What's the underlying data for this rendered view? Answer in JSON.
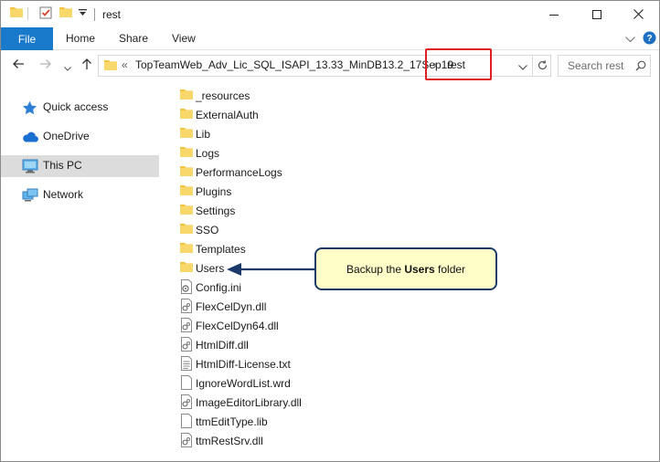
{
  "window": {
    "title": "rest",
    "controls": {
      "minimize": "minimize-icon",
      "maximize": "maximize-icon",
      "close": "close-icon"
    }
  },
  "ribbon": {
    "tabs": [
      "File",
      "Home",
      "Share",
      "View"
    ],
    "file_color": "#1979ca"
  },
  "address": {
    "collapse": "«",
    "crumb": "TopTeamWeb_Adv_Lic_SQL_ISAPI_13.33_MinDB13.2_17Sep19",
    "separator": "›",
    "current": "rest",
    "highlight_color": "#e02020"
  },
  "search": {
    "placeholder": "Search rest"
  },
  "sidebar": {
    "items": [
      {
        "label": "Quick access",
        "icon": "star-icon"
      },
      {
        "label": "OneDrive",
        "icon": "cloud-icon"
      },
      {
        "label": "This PC",
        "icon": "computer-icon",
        "selected": true
      },
      {
        "label": "Network",
        "icon": "network-icon"
      }
    ]
  },
  "files": [
    {
      "name": "_resources",
      "type": "folder"
    },
    {
      "name": "ExternalAuth",
      "type": "folder"
    },
    {
      "name": "Lib",
      "type": "folder"
    },
    {
      "name": "Logs",
      "type": "folder"
    },
    {
      "name": "PerformanceLogs",
      "type": "folder"
    },
    {
      "name": "Plugins",
      "type": "folder"
    },
    {
      "name": "Settings",
      "type": "folder"
    },
    {
      "name": "SSO",
      "type": "folder"
    },
    {
      "name": "Templates",
      "type": "folder"
    },
    {
      "name": "Users",
      "type": "folder"
    },
    {
      "name": "Config.ini",
      "type": "settings-file"
    },
    {
      "name": "FlexCelDyn.dll",
      "type": "dll"
    },
    {
      "name": "FlexCelDyn64.dll",
      "type": "dll"
    },
    {
      "name": "HtmlDiff.dll",
      "type": "dll"
    },
    {
      "name": "HtmlDiff-License.txt",
      "type": "text"
    },
    {
      "name": "IgnoreWordList.wrd",
      "type": "blank"
    },
    {
      "name": "ImageEditorLibrary.dll",
      "type": "dll"
    },
    {
      "name": "ttmEditType.lib",
      "type": "blank"
    },
    {
      "name": "ttmRestSrv.dll",
      "type": "dll"
    }
  ],
  "callout": {
    "prefix": "Backup the ",
    "bold": "Users",
    "suffix": " folder",
    "bg_color": "#fffec8",
    "border_color": "#1b3a6a"
  }
}
